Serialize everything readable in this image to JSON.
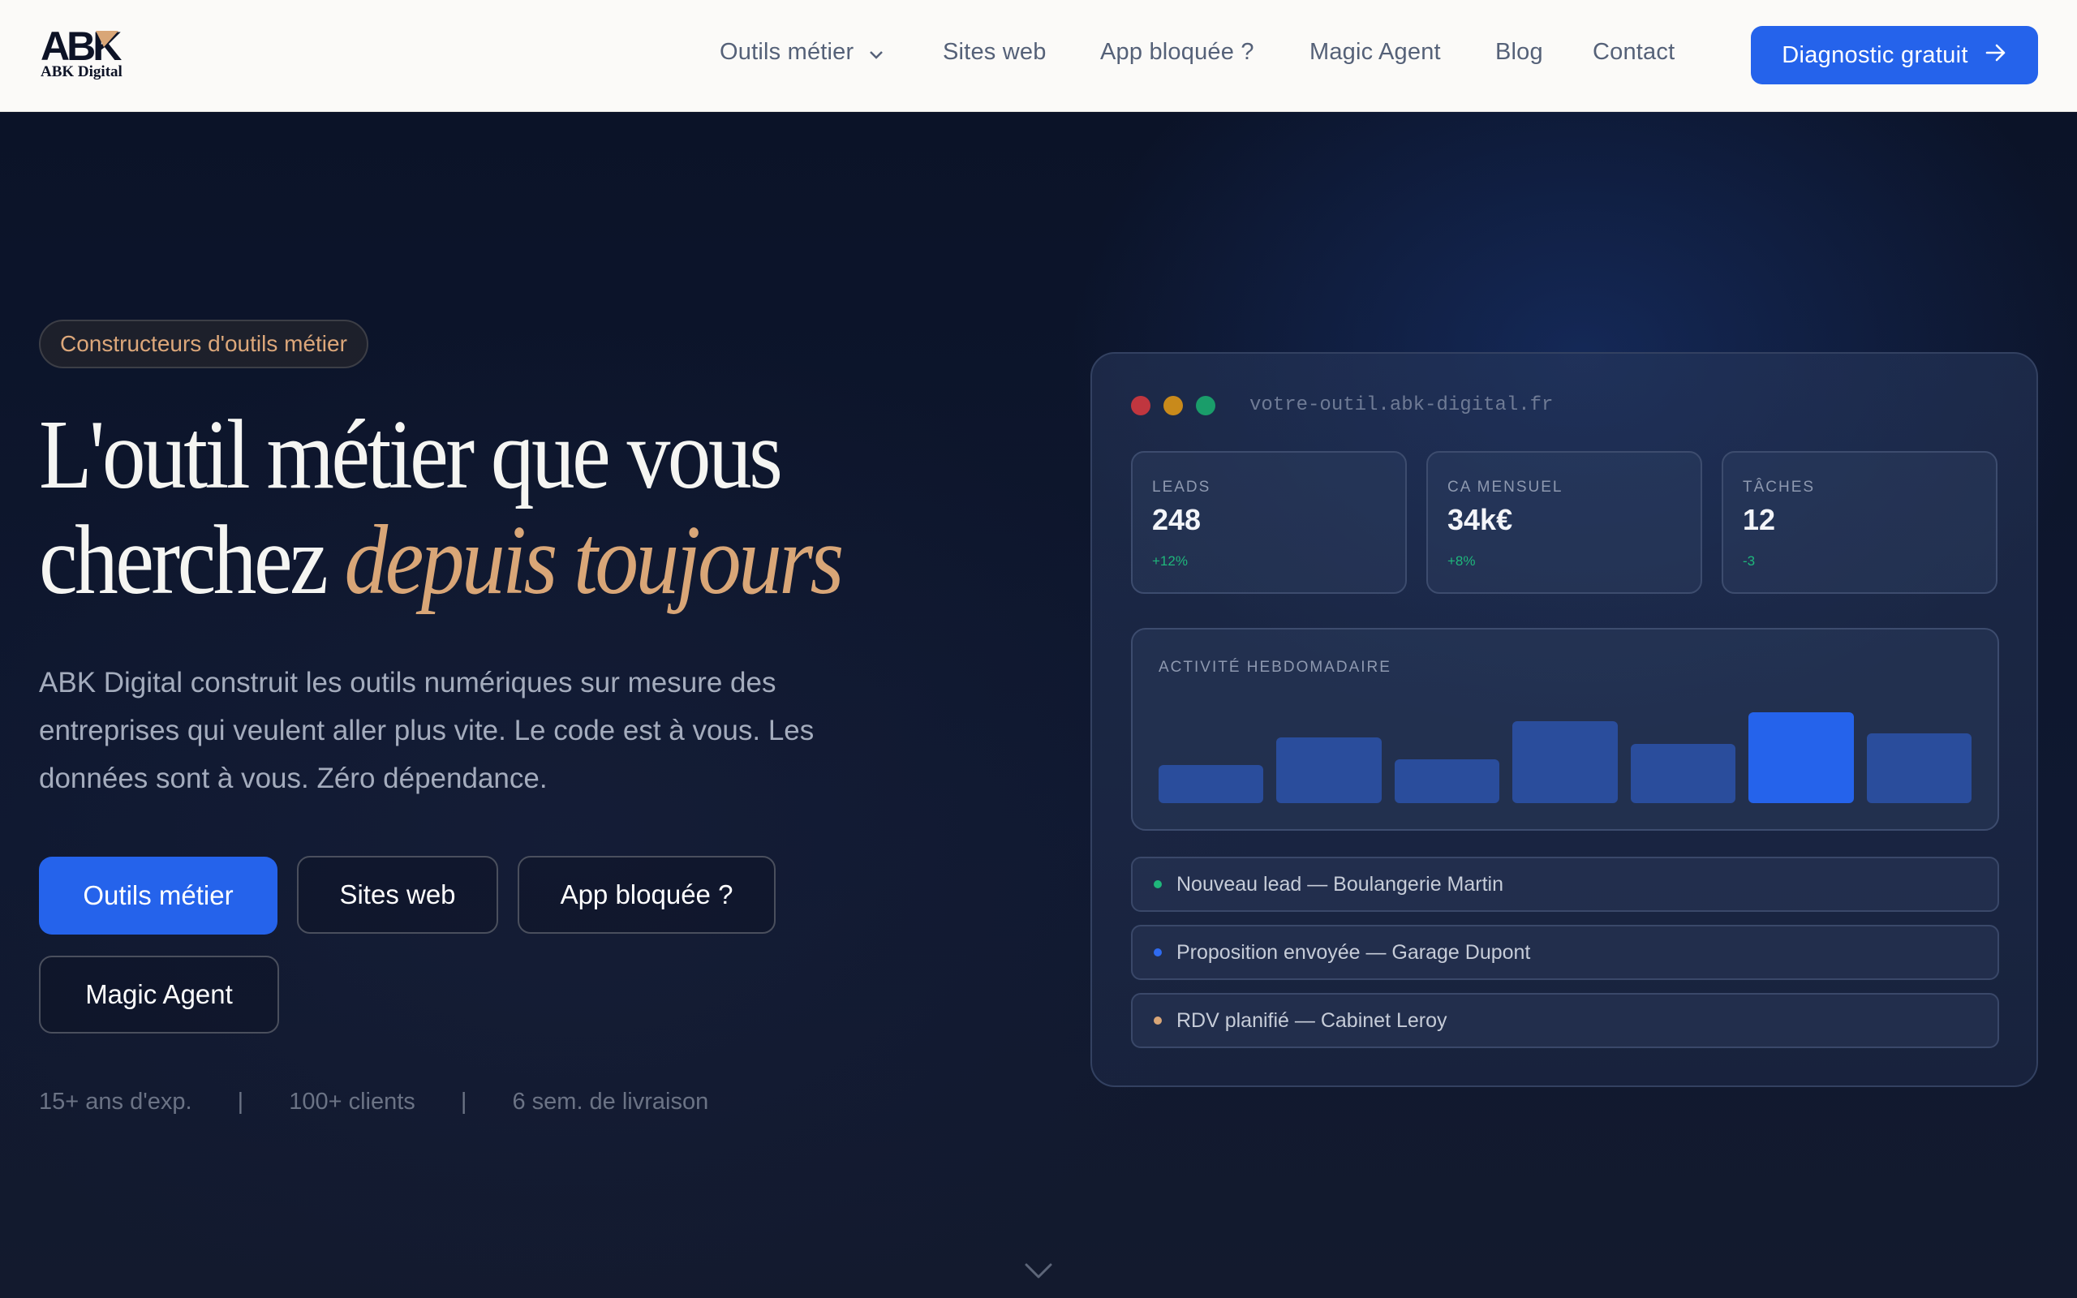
{
  "brand": {
    "logo_mark": "ABK",
    "logo_sub": "ABK Digital"
  },
  "nav": {
    "links": [
      {
        "label": "Outils métier",
        "icon": "chevron-down-icon"
      },
      {
        "label": "Sites web"
      },
      {
        "label": "App bloquée ?"
      },
      {
        "label": "Magic Agent"
      },
      {
        "label": "Blog"
      },
      {
        "label": "Contact"
      }
    ],
    "cta": {
      "label": "Diagnostic gratuit",
      "icon": "arrow-right-icon"
    }
  },
  "hero": {
    "badge": "Constructeurs d'outils métier",
    "headline_line1": "L'outil métier que vous",
    "headline_line2_plain": "cherchez",
    "headline_line2_accent": "depuis toujours",
    "lead": "ABK Digital construit les outils numériques sur mesure des entreprises qui veulent aller plus vite. Le code est à vous. Les données sont à vous. Zéro dépendance.",
    "buttons": [
      {
        "label": "Outils métier",
        "style": "primary"
      },
      {
        "label": "Sites web",
        "style": "outline"
      },
      {
        "label": "App bloquée ?",
        "style": "outline"
      },
      {
        "label": "Magic Agent",
        "style": "outline"
      }
    ],
    "stats": [
      "15+ ans d'exp.",
      "100+ clients",
      "6 sem. de livraison"
    ],
    "stats_separator": "|",
    "scroll_icon": "chevron-down-icon"
  },
  "mock": {
    "window_dots": [
      "#c0363f",
      "#c98a1b",
      "#1a9d6a"
    ],
    "url": "votre-outil.abk-digital.fr",
    "kpis": [
      {
        "label": "LEADS",
        "value": "248",
        "delta": "+12%"
      },
      {
        "label": "CA MENSUEL",
        "value": "34k€",
        "delta": "+8%"
      },
      {
        "label": "TÂCHES",
        "value": "12",
        "delta": "-3"
      }
    ],
    "activity": {
      "title": "ACTIVITÉ HEBDOMADAIRE",
      "bars": [
        0.42,
        0.72,
        0.48,
        0.9,
        0.65,
        1.0,
        0.77
      ],
      "highlight_index": 5
    },
    "feed": [
      {
        "text": "Nouveau lead — Boulangerie Martin",
        "color": "#1fb67b"
      },
      {
        "text": "Proposition envoyée — Garage Dupont",
        "color": "#2f6bf0"
      },
      {
        "text": "RDV planifié — Cabinet Leroy",
        "color": "#d9a677"
      }
    ]
  },
  "colors": {
    "accent": "#2563eb",
    "gold": "#d9a677",
    "positive": "#1fb67b"
  }
}
